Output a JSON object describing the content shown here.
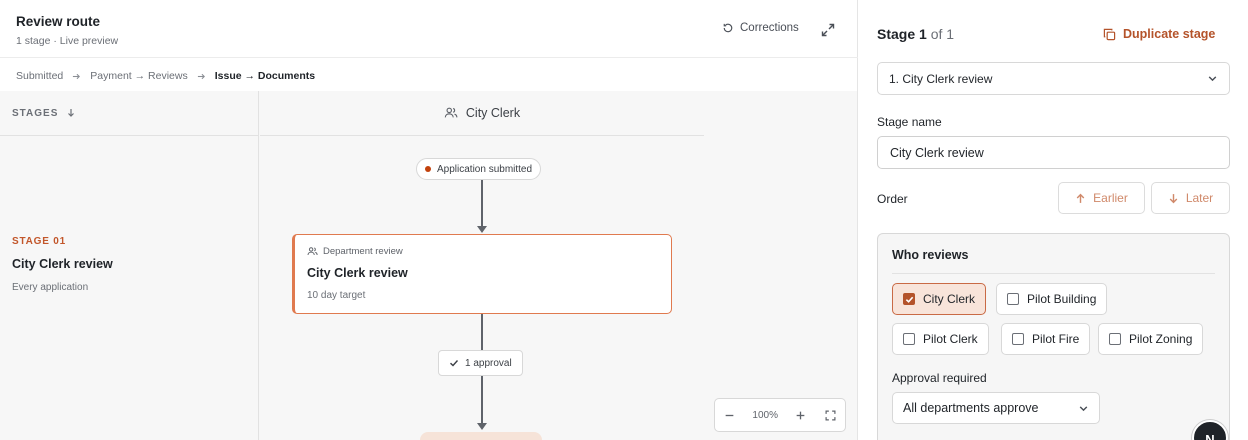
{
  "header": {
    "title": "Review route",
    "subtitle": "1 stage · Live preview",
    "corrections_label": "Corrections"
  },
  "breadcrumb": [
    "Submitted",
    "Payment → Reviews",
    "Issue → Documents"
  ],
  "stages_column": {
    "heading": "STAGES",
    "stage_label": "STAGE 01",
    "stage_name": "City Clerk review",
    "stage_desc": "Every application"
  },
  "lane": {
    "heading": "City Clerk",
    "start_pill": "Application submitted",
    "card_kicker": "Department review",
    "card_title": "City Clerk review",
    "card_meta": "10 day target",
    "approval_pill": "1 approval"
  },
  "zoom": {
    "level": "100%"
  },
  "panel": {
    "stage_counter_prefix": "Stage ",
    "stage_counter_num": "1",
    "stage_counter_suffix": "of 1",
    "duplicate_label": "Duplicate stage",
    "selected_stage": "1. City Clerk review",
    "stage_name_label": "Stage name",
    "stage_name_value": "City Clerk review",
    "order_label": "Order",
    "earlier_label": "Earlier",
    "later_label": "Later",
    "who_reviews_label": "Who reviews",
    "reviewers": [
      {
        "label": "City Clerk",
        "checked": true
      },
      {
        "label": "Pilot Building",
        "checked": false
      },
      {
        "label": "Pilot Clerk",
        "checked": false
      },
      {
        "label": "Pilot Fire",
        "checked": false
      },
      {
        "label": "Pilot Zoning",
        "checked": false
      }
    ],
    "approval_required_label": "Approval required",
    "approval_required_value": "All departments approve"
  },
  "user": {
    "avatar_initial": "N"
  },
  "colors": {
    "accent": "#b4532a",
    "card_border": "#e07a4f",
    "start_dot": "#c2410c"
  }
}
